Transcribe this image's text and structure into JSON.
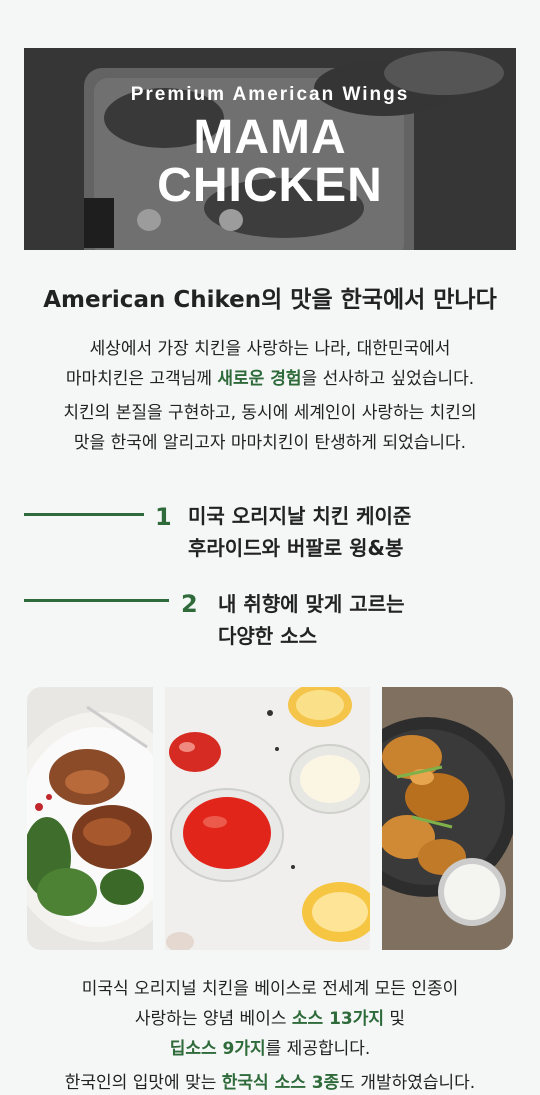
{
  "hero": {
    "subtitle": "Premium American Wings",
    "title_line1": "MAMA",
    "title_line2": "CHICKEN"
  },
  "headline": "American Chiken의 맛을 한국에서 만나다",
  "intro": {
    "p1_line1": "세상에서 가장 치킨을 사랑하는 나라, 대한민국에서",
    "p1_line2_before": "마마치킨은 고객님께 ",
    "p1_line2_highlight": "새로운 경험",
    "p1_line2_after": "을 선사하고 싶었습니다.",
    "p2_line1": "치킨의 본질을 구현하고, 동시에 세계인이 사랑하는 치킨의",
    "p2_line2": "맛을 한국에 알리고자 마마치킨이 탄생하게 되었습니다."
  },
  "features": [
    {
      "number": "1",
      "line1": "미국 오리지날 치킨 케이준",
      "line2": "후라이드와 버팔로 윙&봉"
    },
    {
      "number": "2",
      "line1": "내 취향에 맞게 고르는",
      "line2": "다양한 소스"
    }
  ],
  "photos": [
    {
      "icon": "roast-chicken-photo"
    },
    {
      "icon": "dipping-sauces-photo"
    },
    {
      "icon": "chicken-wings-skillet-photo"
    }
  ],
  "sauce_text": {
    "line1": "미국식 오리지널 치킨을 베이스로 전세계 모든 인종이",
    "line2_before": "사랑하는 양념 베이스 ",
    "line2_highlight": "소스 13가지",
    "line2_after": " 및",
    "line3_highlight": "딥소스 9가지",
    "line3_after": "를 제공합니다."
  },
  "korean_text": {
    "before": "한국인의 입맛에 맞는 ",
    "highlight": "한국식 소스 3종",
    "after": "도 개발하였습니다."
  },
  "colors": {
    "accent": "#2f6b3a",
    "background": "#f5f7f7"
  }
}
